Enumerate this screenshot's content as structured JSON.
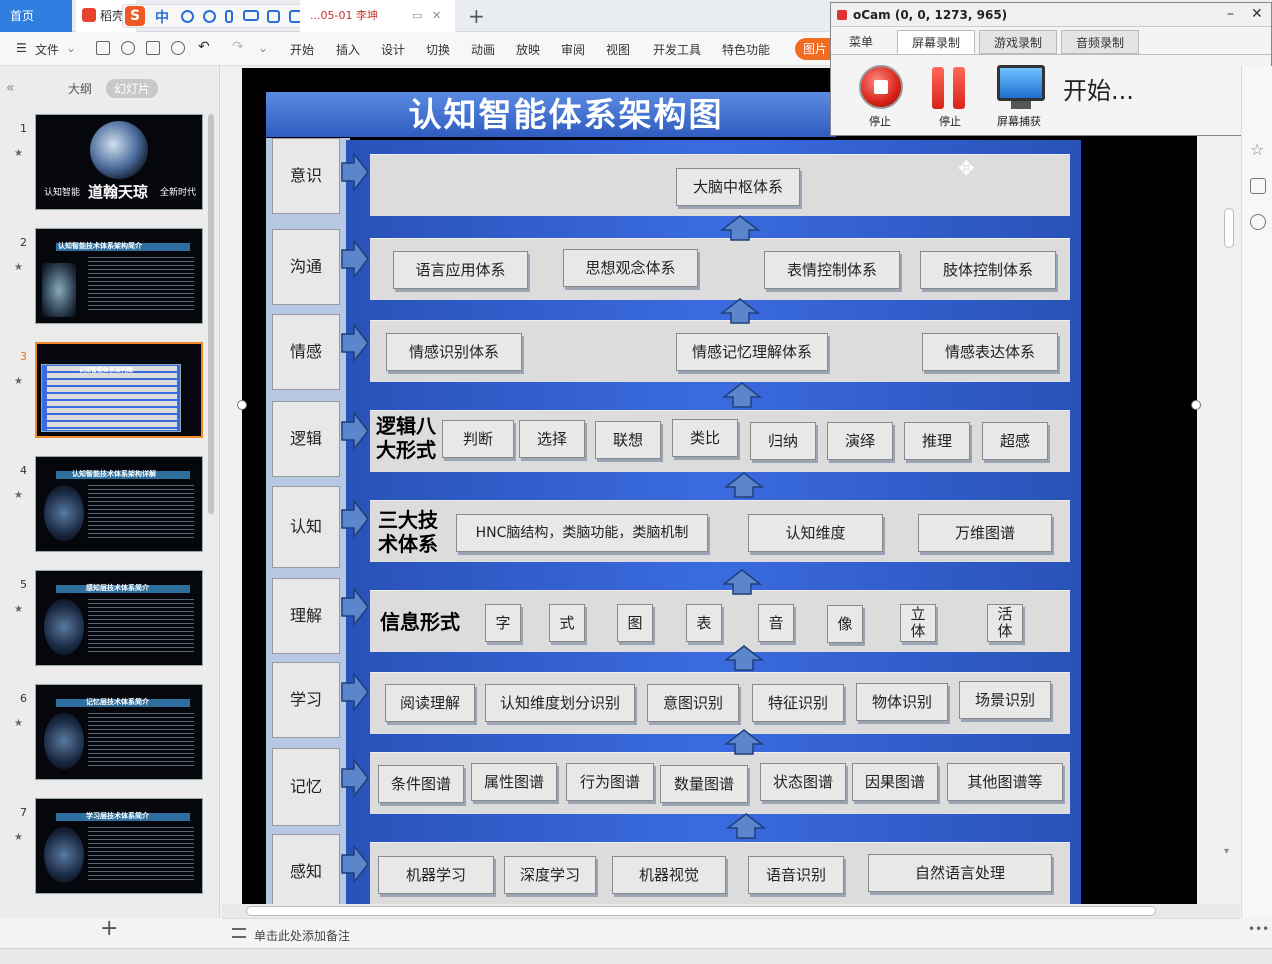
{
  "tabs": {
    "home": "首页",
    "doc": "稻壳",
    "file": "...05-01 李坤"
  },
  "menu": [
    "文件",
    "开始",
    "插入",
    "设计",
    "切换",
    "动画",
    "放映",
    "审阅",
    "视图",
    "开发工具",
    "特色功能"
  ],
  "picture_button": "图片",
  "left_panel": {
    "tab_outline": "大纲",
    "tab_slides": "幻灯片",
    "thumbnails": [
      {
        "num": "1",
        "caption": "道翰天琼",
        "left_caption": "认知智能",
        "right_caption": "全新时代"
      },
      {
        "num": "2",
        "caption": "认知智能技术体系架构简介"
      },
      {
        "num": "3",
        "caption": "认知智能体系架构图"
      },
      {
        "num": "4",
        "caption": "认知智能技术体系架构详解"
      },
      {
        "num": "5",
        "caption": "感知层技术体系简介"
      },
      {
        "num": "6",
        "caption": "记忆层技术体系简介"
      },
      {
        "num": "7",
        "caption": "学习层技术体系简介"
      }
    ],
    "add_slide": "+"
  },
  "slide": {
    "title": "认知智能体系架构图",
    "layers": [
      {
        "left": "意识",
        "boxes": [
          "大脑中枢体系"
        ]
      },
      {
        "left": "沟通",
        "boxes": [
          "语言应用体系",
          "思想观念体系",
          "表情控制体系",
          "肢体控制体系"
        ]
      },
      {
        "left": "情感",
        "boxes": [
          "情感识别体系",
          "情感记忆理解体系",
          "情感表达体系"
        ]
      },
      {
        "left": "逻辑",
        "label": "逻辑八大形式",
        "boxes": [
          "判断",
          "选择",
          "联想",
          "类比",
          "归纳",
          "演绎",
          "推理",
          "超感"
        ]
      },
      {
        "left": "认知",
        "label": "三大技术体系",
        "boxes": [
          "HNC脑结构，类脑功能，类脑机制",
          "认知维度",
          "万维图谱"
        ]
      },
      {
        "left": "理解",
        "label": "信息形式",
        "boxes": [
          "字",
          "式",
          "图",
          "表",
          "音",
          "像",
          "立体",
          "活体"
        ]
      },
      {
        "left": "学习",
        "boxes": [
          "阅读理解",
          "认知维度划分识别",
          "意图识别",
          "特征识别",
          "物体识别",
          "场景识别"
        ]
      },
      {
        "left": "记忆",
        "boxes": [
          "条件图谱",
          "属性图谱",
          "行为图谱",
          "数量图谱",
          "状态图谱",
          "因果图谱",
          "其他图谱等"
        ]
      },
      {
        "left": "感知",
        "boxes": [
          "机器学习",
          "深度学习",
          "机器视觉",
          "语音识别",
          "自然语言处理"
        ]
      }
    ]
  },
  "ocam": {
    "title": "oCam (0, 0, 1273, 965)",
    "tabs": [
      "菜单",
      "屏幕录制",
      "游戏录制",
      "音频录制"
    ],
    "buttons": [
      "停止",
      "停止",
      "屏幕捕获"
    ],
    "status": "开始..."
  },
  "notes_placeholder": "单击此处添加备注",
  "colors": {
    "accent": "#2f7fe0",
    "slide_board": "#3a6be0",
    "selected_thumb": "#f08a2a"
  }
}
